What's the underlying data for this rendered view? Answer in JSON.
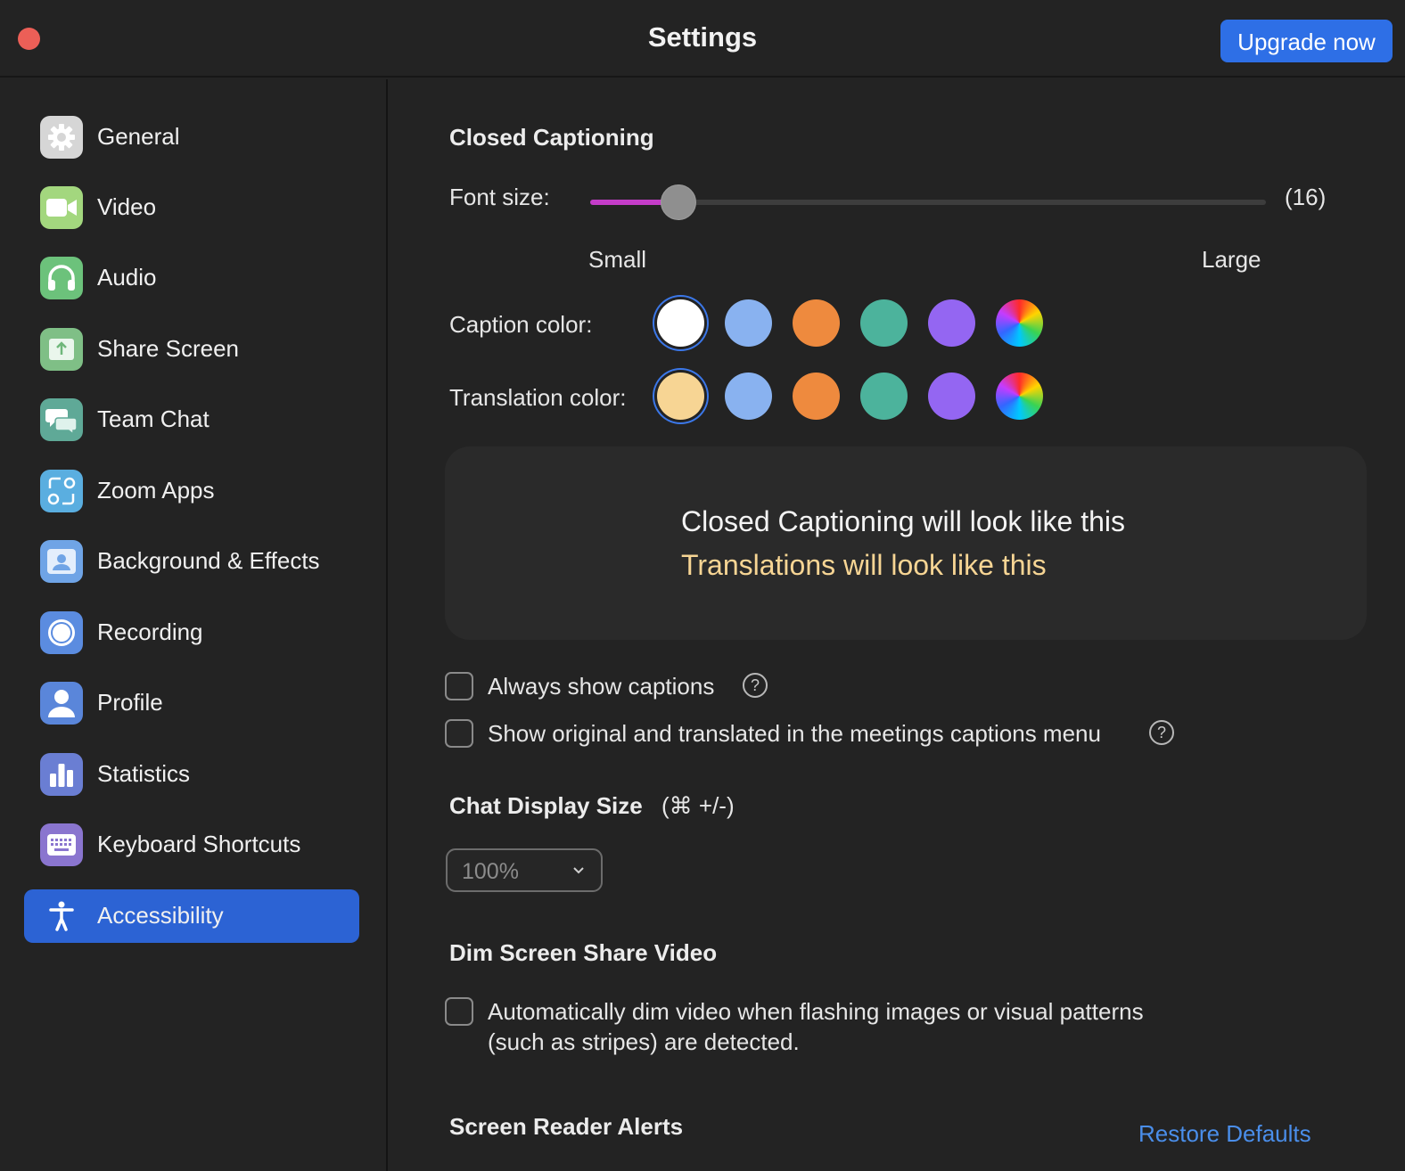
{
  "window": {
    "title": "Settings",
    "upgrade_label": "Upgrade now"
  },
  "sidebar": {
    "items": [
      {
        "label": "General",
        "icon": "gear-icon",
        "color": "#d9d9d9"
      },
      {
        "label": "Video",
        "icon": "video-camera-icon",
        "color": "#9fd67c"
      },
      {
        "label": "Audio",
        "icon": "headphones-icon",
        "color": "#6cc27b"
      },
      {
        "label": "Share Screen",
        "icon": "share-screen-icon",
        "color": "#7fbf86"
      },
      {
        "label": "Team Chat",
        "icon": "chat-bubbles-icon",
        "color": "#5fa997"
      },
      {
        "label": "Zoom Apps",
        "icon": "apps-icon",
        "color": "#5aaee0"
      },
      {
        "label": "Background & Effects",
        "icon": "person-background-icon",
        "color": "#6fa4e6"
      },
      {
        "label": "Recording",
        "icon": "record-icon",
        "color": "#5b8ce0"
      },
      {
        "label": "Profile",
        "icon": "person-icon",
        "color": "#5a86da"
      },
      {
        "label": "Statistics",
        "icon": "bar-chart-icon",
        "color": "#6a7ed3"
      },
      {
        "label": "Keyboard Shortcuts",
        "icon": "keyboard-icon",
        "color": "#8a75cf"
      },
      {
        "label": "Accessibility",
        "icon": "accessibility-icon",
        "color": "#2c63d4",
        "active": true
      }
    ]
  },
  "captioning": {
    "heading": "Closed Captioning",
    "font_size_label": "Font size:",
    "font_size_value": "(16)",
    "font_size_level": 0.13,
    "small_label": "Small",
    "large_label": "Large",
    "caption_color_label": "Caption color:",
    "translation_color_label": "Translation color:",
    "caption_colors": [
      "#ffffff",
      "#89b2f0",
      "#ee8a3e",
      "#4cb39c",
      "#9466f2",
      "rainbow"
    ],
    "caption_selected": 0,
    "translation_colors": [
      "#f7d594",
      "#89b2f0",
      "#ee8a3e",
      "#4cb39c",
      "#9466f2",
      "rainbow"
    ],
    "translation_selected": 0,
    "preview_caption": "Closed Captioning will look like this",
    "preview_translation": "Translations will look like this",
    "always_show_label": "Always show captions",
    "show_original_label": "Show original and translated in the meetings captions menu"
  },
  "chat": {
    "heading": "Chat Display Size",
    "shortcut": "(⌘ +/-)",
    "size_value": "100%"
  },
  "dim": {
    "heading": "Dim Screen Share Video",
    "line1": "Automatically dim video when flashing images or visual patterns",
    "line2": "(such as stripes) are detected."
  },
  "alerts": {
    "heading": "Screen Reader Alerts",
    "restore_label": "Restore Defaults"
  }
}
